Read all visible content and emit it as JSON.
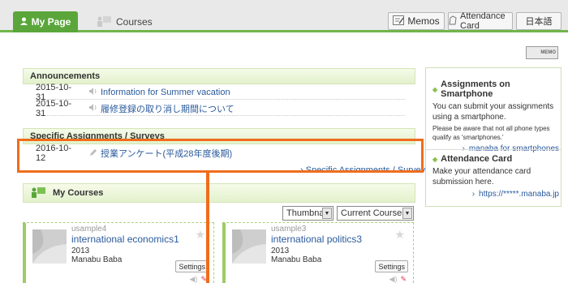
{
  "nav": {
    "my_page_label": "My Page",
    "courses_label": "Courses",
    "memos_label": "Memos",
    "attendance_card_label": "Attendance Card",
    "language_label": "日本語"
  },
  "memo_button_label": "MEMO",
  "announcements": {
    "title": "Announcements",
    "items": [
      {
        "date": "2015-10-31",
        "label": "Information for Summer vacation"
      },
      {
        "date": "2015-10-31",
        "label": "履修登録の取り消し期間について"
      }
    ]
  },
  "specific_assignments": {
    "title": "Specific Assignments / Surveys",
    "items": [
      {
        "date": "2016-10-12",
        "label": "授業アンケート(平成28年度後期)"
      }
    ],
    "more_link": "Specific Assignments / Surveys"
  },
  "sidebar": {
    "smartphone": {
      "title": "Assignments on Smartphone",
      "text": "You can submit your assignments using a smartphone.",
      "note": "Please be aware that not all phone types qualify as 'smartphones.'",
      "link": "manaba for smartphones"
    },
    "attendance": {
      "title": "Attendance Card",
      "text": "Make your attendance card submission here.",
      "link": "https://*****.manaba.jp"
    }
  },
  "my_courses": {
    "title": "My Courses",
    "view_select": "Thumbnail",
    "filter_select": "Current Courses",
    "cards": [
      {
        "id": "usample4",
        "name": "international economics1",
        "year": "2013",
        "teacher": "Manabu Baba",
        "settings_label": "Settings"
      },
      {
        "id": "usample3",
        "name": "international politics3",
        "year": "2013",
        "teacher": "Manabu Baba",
        "settings_label": "Settings"
      }
    ]
  },
  "colors": {
    "accent_green": "#5aa63a",
    "link_blue": "#2a5a9c",
    "highlight_orange": "#ef6d1c"
  },
  "icons": [
    "user-icon",
    "courses-icon",
    "memo-icon",
    "attendance-icon",
    "speaker-icon",
    "pencil-icon",
    "chevron-right-icon",
    "star-icon"
  ]
}
